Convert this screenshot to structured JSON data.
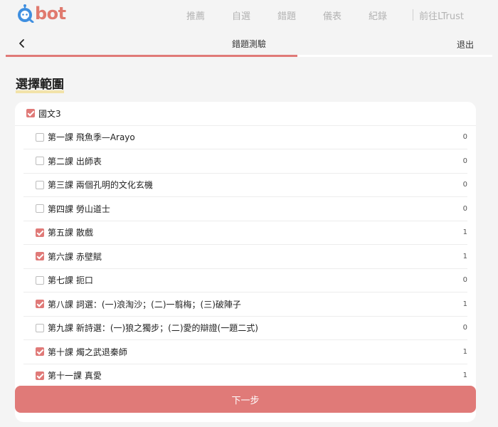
{
  "brand": {
    "name": "bot"
  },
  "nav": [
    {
      "label": "推薦"
    },
    {
      "label": "自選"
    },
    {
      "label": "錯題"
    },
    {
      "label": "儀表"
    },
    {
      "label": "紀錄"
    }
  ],
  "nav_external": {
    "label": "前往LTrust"
  },
  "header": {
    "title": "錯題測驗",
    "exit_label": "退出",
    "progress_fraction": 0.6
  },
  "section_title": "選擇範圍",
  "parent": {
    "label": "國文3",
    "checked": true
  },
  "lessons": [
    {
      "label": "第一課 飛魚季—Arayo",
      "count": "0",
      "checked": false
    },
    {
      "label": "第二課 出師表",
      "count": "0",
      "checked": false
    },
    {
      "label": "第三課 兩個孔明的文化玄機",
      "count": "0",
      "checked": false
    },
    {
      "label": "第四課 勞山道士",
      "count": "0",
      "checked": false
    },
    {
      "label": "第五課 散戲",
      "count": "1",
      "checked": true
    },
    {
      "label": "第六課 赤壁賦",
      "count": "1",
      "checked": true
    },
    {
      "label": "第七課 扼口",
      "count": "0",
      "checked": false
    },
    {
      "label": "第八課 詞選：(一)浪淘沙；(二)一翦梅；(三)破陣子",
      "count": "1",
      "checked": true
    },
    {
      "label": "第九課 新詩選：(一)狼之獨步；(二)愛的辯證(一題二式)",
      "count": "0",
      "checked": false
    },
    {
      "label": "第十課 燭之武退秦師",
      "count": "1",
      "checked": true
    },
    {
      "label": "第十一課 真愛",
      "count": "1",
      "checked": true
    }
  ],
  "next_button": {
    "label": "下一步"
  },
  "colors": {
    "accent": "#e07a78",
    "brand": "#e07a6e",
    "brand_blue": "#3f8fe0"
  },
  "icons": {
    "back": "chevron-left-icon",
    "logo": "robot-q-icon"
  }
}
